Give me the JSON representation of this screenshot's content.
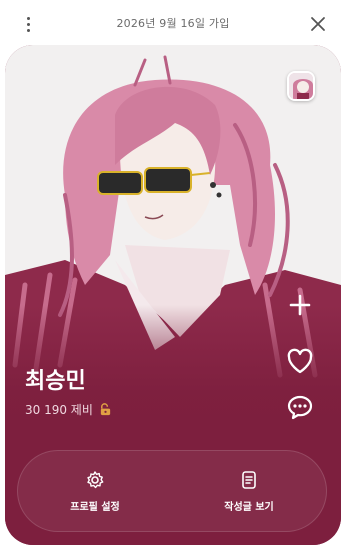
{
  "header": {
    "menu_icon": "kebab-vertical-icon",
    "join_date": "2026년 9월 16일 가입",
    "close_icon": "close-icon"
  },
  "profile": {
    "name": "최승민",
    "count": "30 190 제비",
    "count_icon": "lock-open-icon",
    "image": "illustrated-portrait-pink-long-hair-sunglasses",
    "thumbnail": "profile-thumbnail"
  },
  "actions": [
    {
      "name": "add-button",
      "icon": "plus-icon"
    },
    {
      "name": "like-button",
      "icon": "heart-icon"
    },
    {
      "name": "message-button",
      "icon": "chat-bubble-icon"
    }
  ],
  "bottom_bar": {
    "settings_label": "프로필 설정",
    "settings_icon": "gear-icon",
    "posts_label": "작성글 보기",
    "posts_icon": "document-icon"
  },
  "colors": {
    "card_background": "#7d1f3e",
    "hair": "#d98aa8",
    "text_light": "#ffffff",
    "background": "#ffffff"
  }
}
